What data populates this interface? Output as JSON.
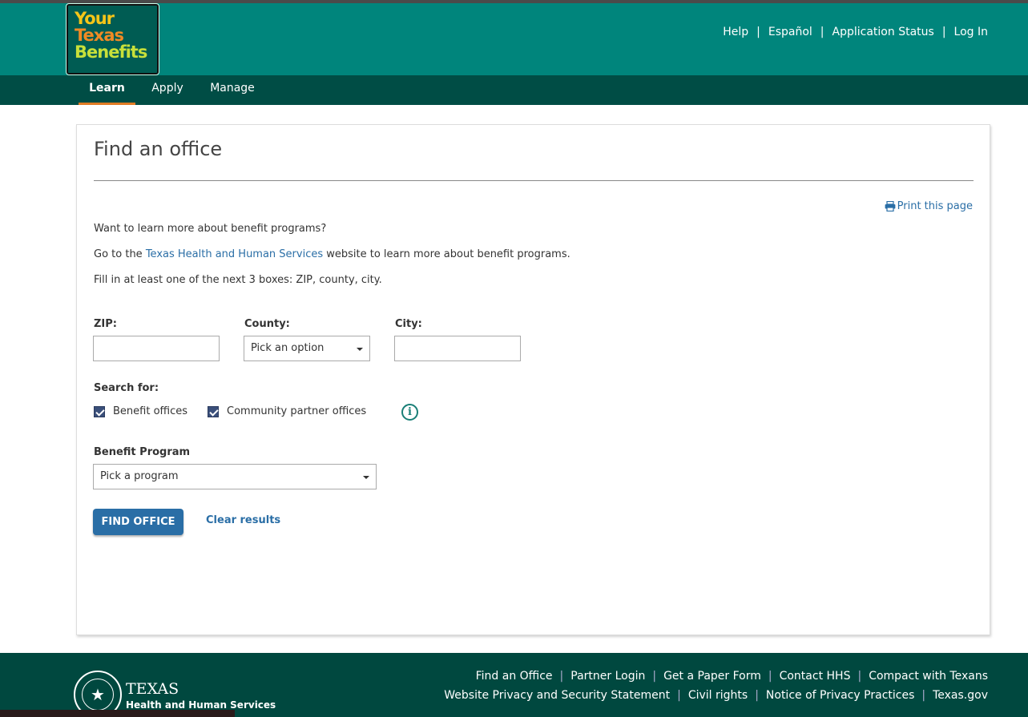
{
  "brand": {
    "logo_line1": "Your",
    "logo_line2": "Texas",
    "logo_line3": "Benefits",
    "colors": {
      "header": "#00857c",
      "nav": "#004d45",
      "accent": "#e07b24",
      "link": "#2a6ea6",
      "footer": "#00483f"
    }
  },
  "top_links": [
    "Help",
    "Español",
    "Application Status",
    "Log In"
  ],
  "nav_tabs": [
    {
      "label": "Learn",
      "active": true
    },
    {
      "label": "Apply",
      "active": false
    },
    {
      "label": "Manage",
      "active": false
    }
  ],
  "page": {
    "title": "Find an office",
    "print_label": "Print this page",
    "intro1": "Want to learn more about benefit programs?",
    "intro2_pre": "Go to the ",
    "intro2_link": "Texas Health and Human Services",
    "intro2_post": " website to learn more about benefit programs.",
    "intro3": "Fill in at least one of the next 3 boxes: ZIP, county, city."
  },
  "form": {
    "zip_label": "ZIP:",
    "zip_value": "",
    "county_label": "County:",
    "county_selected": "Pick an option",
    "city_label": "City:",
    "city_value": "",
    "search_for_label": "Search for:",
    "checkbox_benefit": {
      "label": "Benefit offices",
      "checked": true
    },
    "checkbox_partner": {
      "label": "Community partner offices",
      "checked": true
    },
    "info_icon": "info-icon",
    "program_label": "Benefit Program",
    "program_selected": "Pick a program",
    "find_button": "FIND OFFICE",
    "clear_link": "Clear results"
  },
  "footer": {
    "seal_icon": "texas-seal-icon",
    "org_line1": "TEXAS",
    "org_line2": "Health and Human Services",
    "links_row1": [
      "Find an Office",
      "Partner Login",
      "Get a Paper Form",
      "Contact HHS",
      "Compact with Texans"
    ],
    "links_row2": [
      "Website Privacy and Security Statement",
      "Civil rights",
      "Notice of Privacy Practices",
      "Texas.gov"
    ]
  }
}
